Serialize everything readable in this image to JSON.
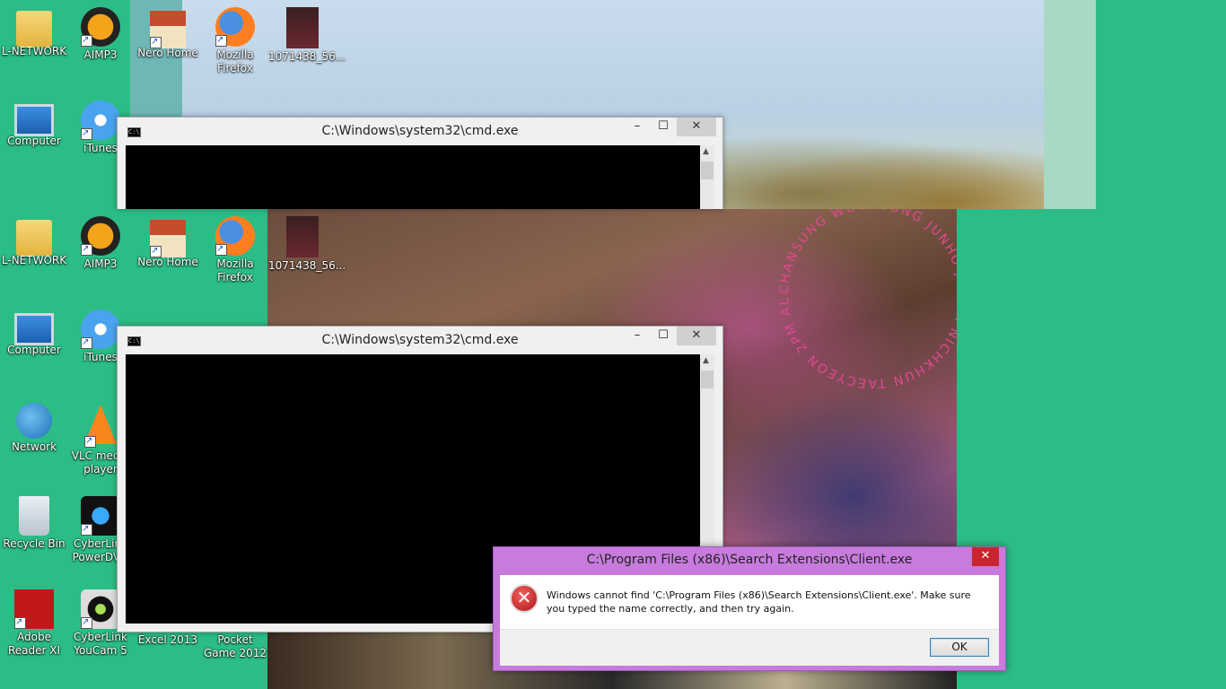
{
  "desktop_icons_top": [
    {
      "label": "L-NETWORK",
      "icon": "folder-user-icon"
    },
    {
      "label": "AIMP3",
      "icon": "aimp-icon"
    },
    {
      "label": "Nero Home",
      "icon": "nero-home-icon"
    },
    {
      "label": "Mozilla Firefox",
      "icon": "firefox-icon"
    },
    {
      "label": "1071438_56...",
      "icon": "photo-file-icon"
    },
    {
      "label": "Computer",
      "icon": "computer-icon"
    },
    {
      "label": "iTunes",
      "icon": "itunes-icon"
    }
  ],
  "desktop_icons_main": [
    {
      "label": "L-NETWORK",
      "icon": "folder-user-icon"
    },
    {
      "label": "AIMP3",
      "icon": "aimp-icon"
    },
    {
      "label": "Nero Home",
      "icon": "nero-home-icon"
    },
    {
      "label": "Mozilla Firefox",
      "icon": "firefox-icon"
    },
    {
      "label": "1071438_56...",
      "icon": "photo-file-icon"
    },
    {
      "label": "Computer",
      "icon": "computer-icon"
    },
    {
      "label": "iTunes",
      "icon": "itunes-icon"
    },
    {
      "label": "Network",
      "icon": "network-icon"
    },
    {
      "label": "VLC media player",
      "icon": "vlc-icon"
    },
    {
      "label": "Recycle Bin",
      "icon": "recycle-bin-icon"
    },
    {
      "label": "CyberLink PowerDVD",
      "icon": "powerdvd-icon"
    },
    {
      "label": "Adobe Reader XI",
      "icon": "adobe-reader-icon"
    },
    {
      "label": "CyberLink YouCam 5",
      "icon": "youcam-icon"
    },
    {
      "label": "Excel 2013",
      "icon": "excel-icon"
    },
    {
      "label": "Pocket Game 2012",
      "icon": "pocket-game-icon"
    }
  ],
  "cmd_window_top": {
    "title": "C:\\Windows\\system32\\cmd.exe",
    "app_icon_text": "C:\\.",
    "minimize": "–",
    "maximize": "☐",
    "close": "✕"
  },
  "cmd_window_main": {
    "title": "C:\\Windows\\system32\\cmd.exe",
    "app_icon_text": "C:\\.",
    "minimize": "–",
    "maximize": "☐",
    "close": "✕"
  },
  "error_dialog": {
    "title": "C:\\Program Files (x86)\\Search Extensions\\Client.exe",
    "close": "✕",
    "icon": "error-icon",
    "icon_glyph": "✕",
    "message": "Windows cannot find 'C:\\Program Files (x86)\\Search Extensions\\Client.exe'. Make sure you typed the name correctly, and then try again.",
    "ok_label": "OK"
  },
  "wallpaper_text": "CHANSUNG WOOYOUNG JUNHO JUN. K NICHKHUN TAECYEON 2PM ALBUM"
}
